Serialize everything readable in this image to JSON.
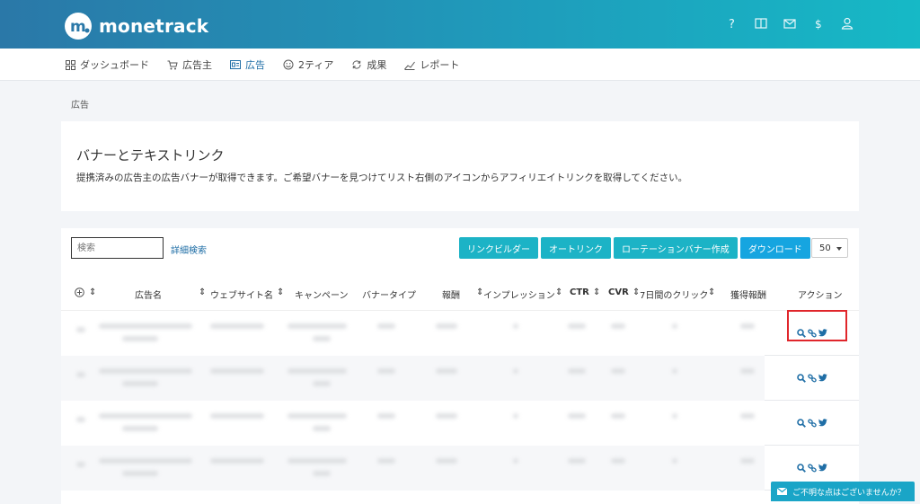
{
  "brand": {
    "name": "monetrack"
  },
  "header_icons": [
    "help-icon",
    "book-icon",
    "mail-icon",
    "dollar-icon",
    "user-icon"
  ],
  "nav": [
    {
      "label": "ダッシュボード",
      "icon": "grid-icon",
      "active": false
    },
    {
      "label": "広告主",
      "icon": "cart-icon",
      "active": false
    },
    {
      "label": "広告",
      "icon": "banner-icon",
      "active": true
    },
    {
      "label": "2ティア",
      "icon": "smile-icon",
      "active": false
    },
    {
      "label": "成果",
      "icon": "refresh-icon",
      "active": false
    },
    {
      "label": "レポート",
      "icon": "chart-icon",
      "active": false
    }
  ],
  "breadcrumb": "広告",
  "intro": {
    "title": "バナーとテキストリンク",
    "description": "提携済みの広告主の広告バナーが取得できます。ご希望バナーを見つけてリスト右側のアイコンからアフィリエイトリンクを取得してください。"
  },
  "toolbar": {
    "search_placeholder": "検索",
    "advanced_search": "詳細検索",
    "link_builder": "リンクビルダー",
    "auto_link": "オートリンク",
    "rotation_banner": "ローテーションバナー作成",
    "download": "ダウンロード",
    "per_page": "50"
  },
  "table": {
    "headers": {
      "ad_name": "広告名",
      "website": "ウェブサイト名",
      "campaign": "キャンペーン",
      "banner_type": "バナータイプ",
      "reward": "報酬",
      "impression": "インプレッション",
      "ctr": "CTR",
      "cvr": "CVR",
      "clicks_7d": "7日間のクリック",
      "earned": "獲得報酬",
      "action": "アクション"
    },
    "row_count": 4
  },
  "help": {
    "label": "ご不明な点はございませんか？"
  },
  "colors": {
    "accent": "#1cb3c6",
    "primary": "#1f6ea6",
    "highlight": "#e0262b"
  }
}
